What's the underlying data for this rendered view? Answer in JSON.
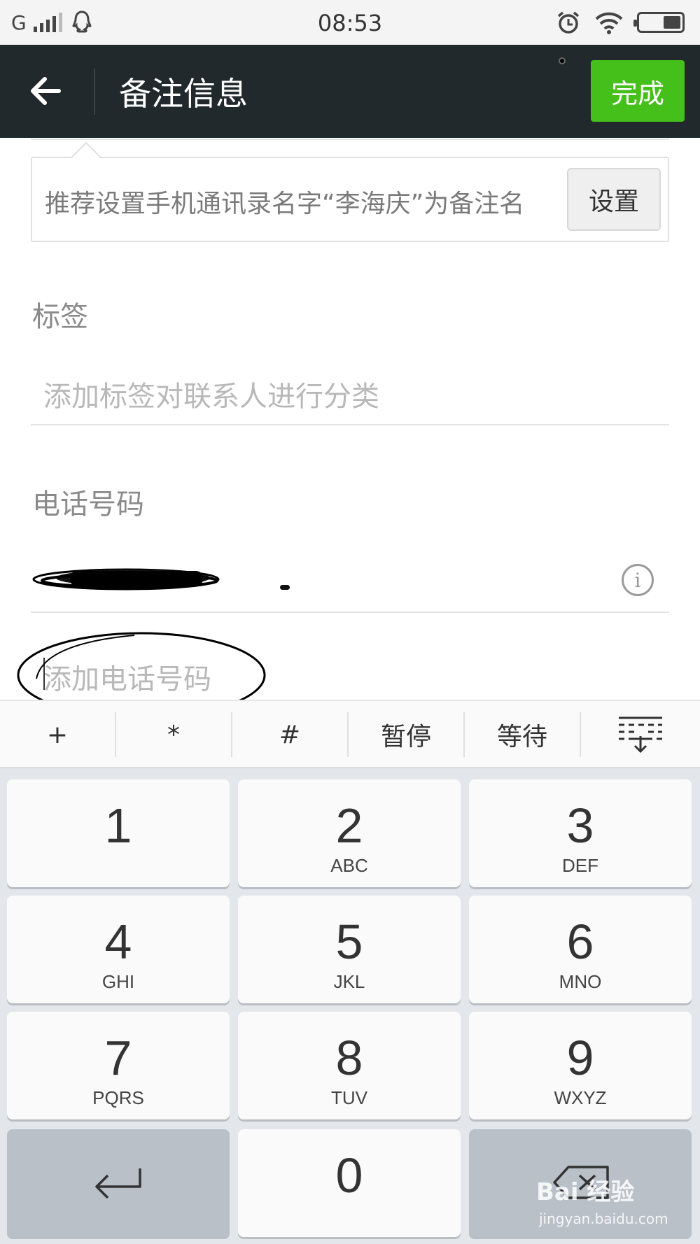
{
  "status_bar": {
    "carrier": "G",
    "time": "08:53",
    "icons": [
      "signal-icon",
      "qq-icon",
      "alarm-icon",
      "wifi-icon",
      "battery-icon"
    ]
  },
  "header": {
    "title": "备注信息",
    "done_label": "完成"
  },
  "suggestion": {
    "text": "推荐设置手机通讯录名字“李海庆”为备注名",
    "button_label": "设置"
  },
  "tags": {
    "label": "标签",
    "placeholder": "添加标签对联系人进行分类"
  },
  "phone": {
    "label": "电话号码",
    "add_placeholder": "添加电话号码"
  },
  "symbol_bar": {
    "keys": [
      "+",
      "*",
      "#",
      "暂停",
      "等待"
    ]
  },
  "keypad": {
    "keys": [
      {
        "num": "1",
        "letters": ""
      },
      {
        "num": "2",
        "letters": "ABC"
      },
      {
        "num": "3",
        "letters": "DEF"
      },
      {
        "num": "4",
        "letters": "GHI"
      },
      {
        "num": "5",
        "letters": "JKL"
      },
      {
        "num": "6",
        "letters": "MNO"
      },
      {
        "num": "7",
        "letters": "PQRS"
      },
      {
        "num": "8",
        "letters": "TUV"
      },
      {
        "num": "9",
        "letters": "WXYZ"
      },
      {
        "num": "0",
        "letters": ""
      }
    ]
  },
  "watermark": {
    "brand": "Bai 经验",
    "url": "jingyan.baidu.com"
  },
  "colors": {
    "title_bar": "#22292c",
    "done_button": "#45c01a",
    "keypad_bg": "#e3e6ea"
  }
}
